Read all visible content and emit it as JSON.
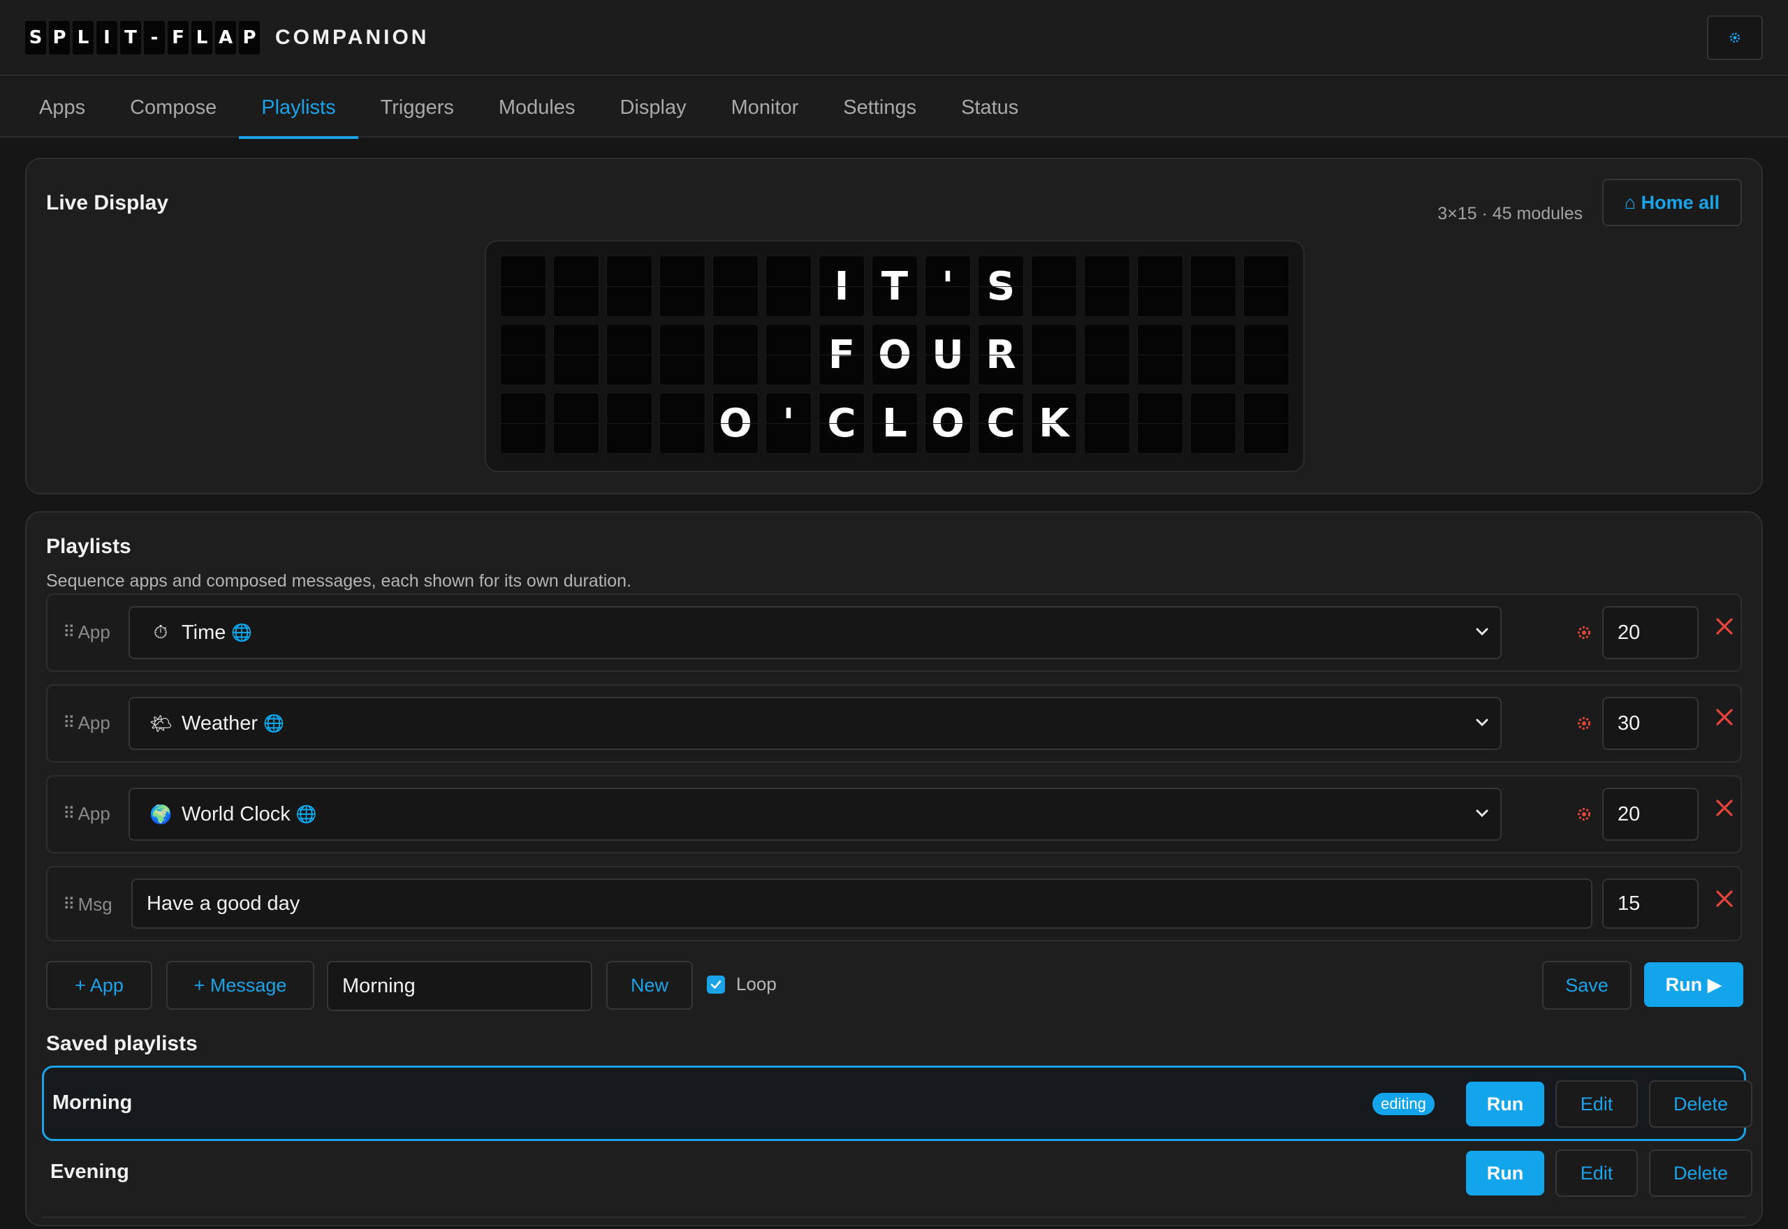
{
  "header": {
    "logo_letters": [
      "S",
      "P",
      "L",
      "I",
      "T",
      "-",
      "F",
      "L",
      "A",
      "P"
    ],
    "logo_word": "COMPANION",
    "settings_icon": "gear-icon"
  },
  "tabs": [
    {
      "label": "Apps",
      "active": false
    },
    {
      "label": "Compose",
      "active": false
    },
    {
      "label": "Playlists",
      "active": true
    },
    {
      "label": "Triggers",
      "active": false
    },
    {
      "label": "Modules",
      "active": false
    },
    {
      "label": "Display",
      "active": false
    },
    {
      "label": "Monitor",
      "active": false
    },
    {
      "label": "Settings",
      "active": false
    },
    {
      "label": "Status",
      "active": false
    }
  ],
  "live": {
    "title": "Live Display",
    "meta": "3×15 · 45 modules",
    "home_all": "⌂ Home all",
    "rows": [
      "      IT'S     ",
      "      FOUR     ",
      "    O'CLOCK    "
    ]
  },
  "playlists": {
    "title": "Playlists",
    "subtitle": "Sequence apps and composed messages, each shown for its own duration.",
    "items": [
      {
        "kind": "App",
        "emoji": "⏱",
        "label": "Time",
        "globe": "🌐",
        "duration": "20"
      },
      {
        "kind": "App",
        "emoji": "🌤",
        "label": "Weather",
        "globe": "🌐",
        "duration": "30"
      },
      {
        "kind": "App",
        "emoji": "🌍",
        "label": "World Clock",
        "globe": "🌐",
        "duration": "20"
      }
    ],
    "message": {
      "kind": "Msg",
      "text": "Have a good day",
      "duration": "15"
    },
    "controls": {
      "add_app": "+ App",
      "add_message": "+ Message",
      "name": "Morning",
      "new": "New",
      "loop_label": "Loop",
      "loop_checked": true,
      "save": "Save",
      "run": "Run ▶"
    },
    "saved_title": "Saved playlists",
    "saved": [
      {
        "name": "Morning",
        "badge": "editing",
        "run": "Run",
        "edit": "Edit",
        "delete": "Delete"
      },
      {
        "name": "Evening",
        "run": "Run",
        "edit": "Edit",
        "delete": "Delete"
      }
    ]
  },
  "colors": {
    "accent": "#1aa3e8",
    "danger": "#e5463b",
    "background": "#161616",
    "card": "#1e1e1e"
  }
}
